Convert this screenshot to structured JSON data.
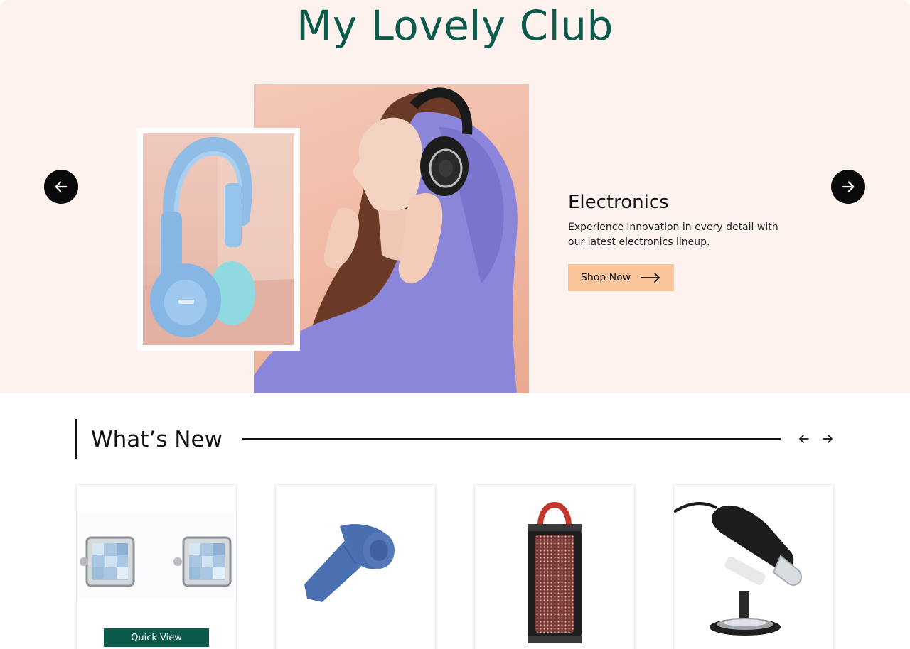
{
  "site": {
    "title": "My Lovely Club"
  },
  "hero": {
    "heading": "Electronics",
    "description": "Experience innovation in every detail with our latest electronics lineup.",
    "cta_label": "Shop Now",
    "prev_icon": "arrow-left-icon",
    "next_icon": "arrow-right-icon",
    "images": [
      "woman-with-headphones-photo",
      "blue-headphones-photo"
    ]
  },
  "whats_new": {
    "title": "What’s New",
    "prev_icon": "arrow-left-icon",
    "next_icon": "arrow-right-icon",
    "products": [
      {
        "image": "cufflinks-photo",
        "quick_view_label": "Quick View"
      },
      {
        "image": "blue-tie-photo"
      },
      {
        "image": "portable-speaker-photo"
      },
      {
        "image": "digital-microscope-photo"
      }
    ]
  },
  "colors": {
    "brand_green": "#0b5a4b",
    "hero_background": "#fdf2ee",
    "cta_peach": "#fbc59c",
    "arrow_black": "#0a0a0a"
  }
}
